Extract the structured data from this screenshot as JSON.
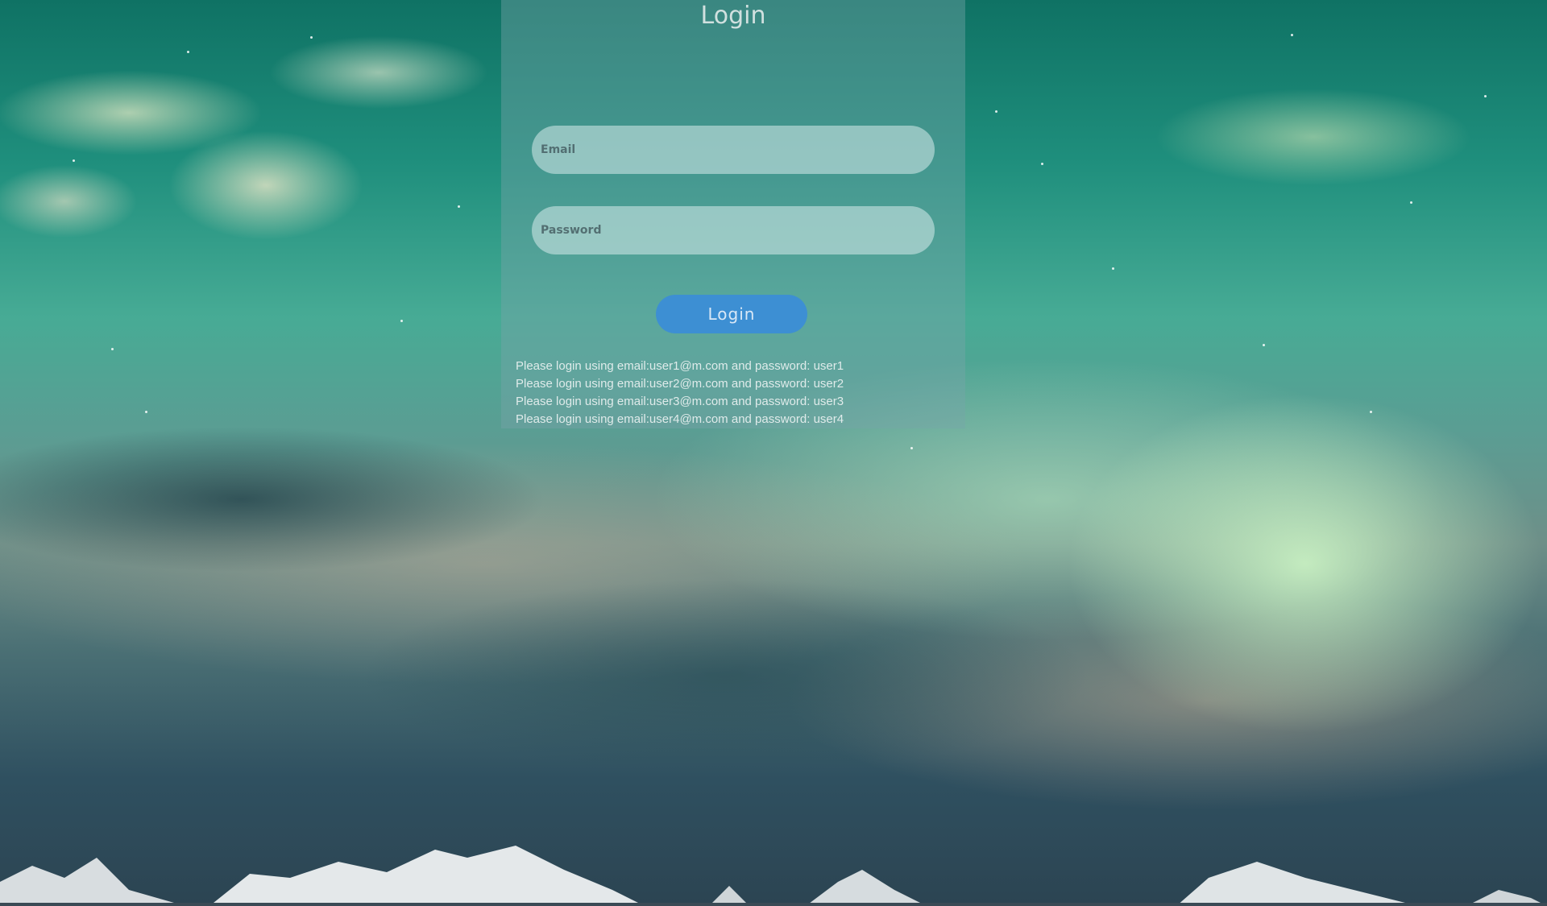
{
  "page": {
    "title": "Login"
  },
  "form": {
    "email_placeholder": "Email",
    "password_placeholder": "Password",
    "login_button": "Login"
  },
  "hints": [
    "Please login using email:user1@m.com and password: user1",
    "Please login using email:user2@m.com and password: user2",
    "Please login using email:user3@m.com and password: user3",
    "Please login using email:user4@m.com and password: user4"
  ],
  "colors": {
    "button": "#3d8fd3",
    "panel": "rgba(120,165,170,0.42)"
  }
}
